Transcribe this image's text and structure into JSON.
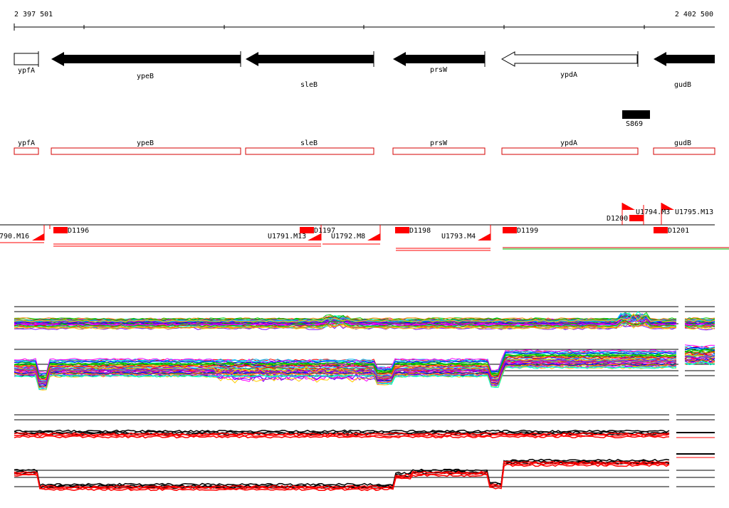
{
  "coordinates": {
    "start": "2 397 501",
    "end": "2 402 500"
  },
  "genes": [
    {
      "name": "ypfA",
      "strand": "+",
      "filled": false
    },
    {
      "name": "ypeB",
      "strand": "-",
      "filled": true
    },
    {
      "name": "sleB",
      "strand": "-",
      "filled": true
    },
    {
      "name": "prsW",
      "strand": "-",
      "filled": true
    },
    {
      "name": "ypdA",
      "strand": "-",
      "filled": false
    },
    {
      "name": "gudB",
      "strand": "-",
      "filled": true
    }
  ],
  "feature_marker": {
    "name": "S869"
  },
  "utr_labels": [
    "790.M16",
    "D1196",
    "U1791.M13",
    "D1197",
    "U1792.M8",
    "D1198",
    "U1793.M4",
    "D1199",
    "D1200",
    "U1794.M3",
    "U1795.M13",
    "D1201"
  ],
  "colors": {
    "gene_filled": "#000000",
    "gene_outline": "#d40000",
    "marker_red": "#ff0000",
    "baseline": "#000000"
  }
}
